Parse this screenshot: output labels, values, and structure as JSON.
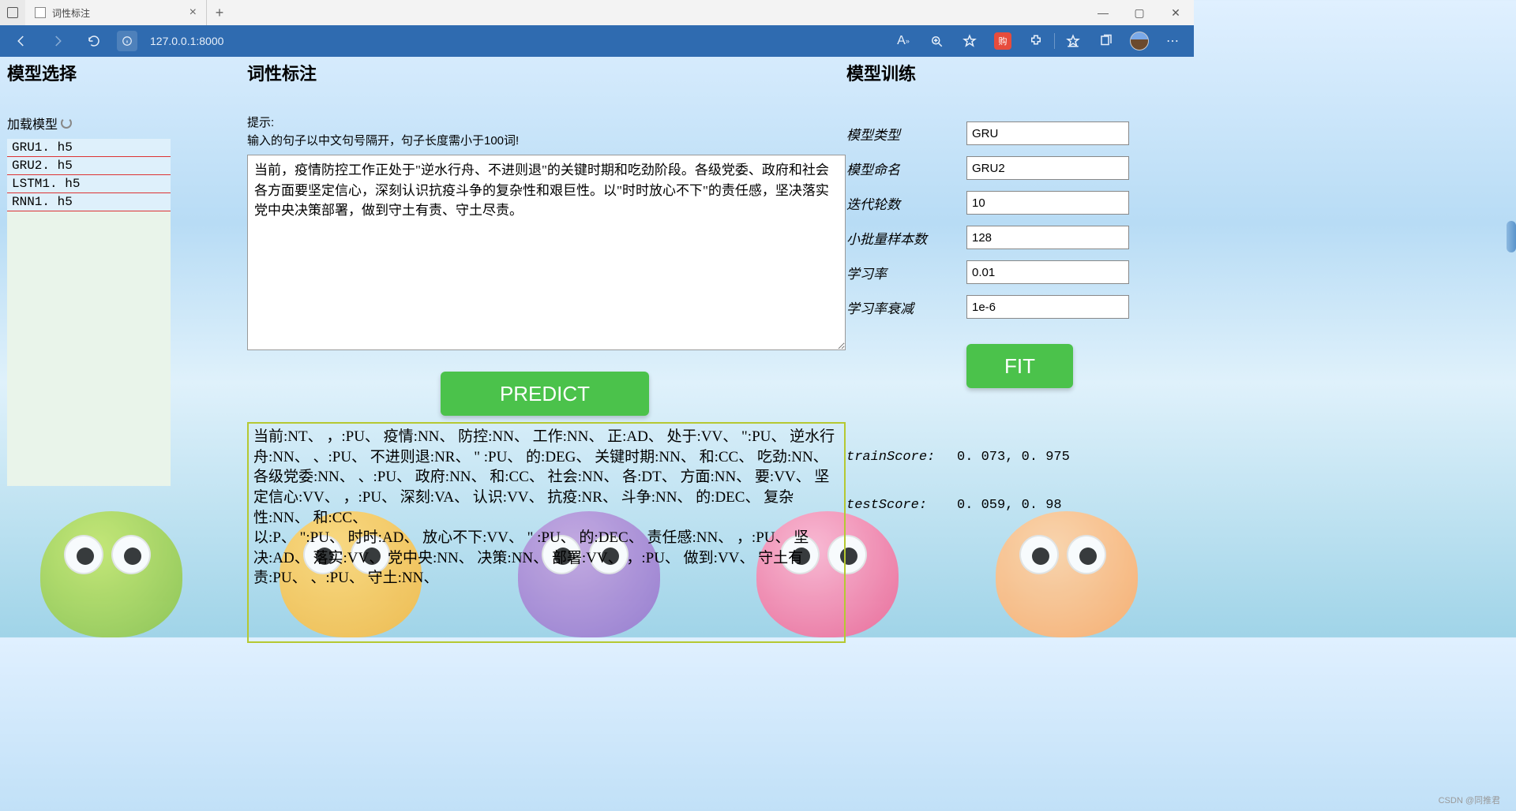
{
  "browser": {
    "tab_title": "词性标注",
    "url": "127.0.0.1:8000",
    "new_tab_tooltip": "+"
  },
  "left": {
    "heading": "模型选择",
    "load_label": "加载模型",
    "models": [
      "GRU1. h5",
      "GRU2. h5",
      "LSTM1. h5",
      "RNN1. h5"
    ]
  },
  "mid": {
    "heading": "词性标注",
    "hint_label": "提示:",
    "hint_text": "输入的句子以中文句号隔开，句子长度需小于100词!",
    "input_text": "当前，疫情防控工作正处于\"逆水行舟、不进则退\"的关键时期和吃劲阶段。各级党委、政府和社会各方面要坚定信心，深刻认识抗疫斗争的复杂性和艰巨性。以\"时时放心不下\"的责任感，坚决落实党中央决策部署，做到守土有责、守土尽责。",
    "predict_label": "PREDICT",
    "result": "当前:NT、 ，:PU、 疫情:NN、 防控:NN、 工作:NN、 正:AD、 处于:VV、 \":PU、 逆水行舟:NN、 、:PU、 不进则退:NR、 \" :PU、 的:DEG、 关键时期:NN、 和:CC、 吃劲:NN、\n各级党委:NN、 、:PU、 政府:NN、 和:CC、 社会:NN、 各:DT、 方面:NN、 要:VV、 坚定信心:VV、 ，:PU、 深刻:VA、 认识:VV、 抗疫:NR、 斗争:NN、 的:DEC、 复杂性:NN、 和:CC、\n以:P、 \":PU、 时时:AD、 放心不下:VV、 \" :PU、 的:DEC、 责任感:NN、 ，:PU、 坚决:AD、 落实:VV、 党中央:NN、 决策:NN、 部署:VV、 ，:PU、 做到:VV、 守土有责:PU、 、:PU、 守土:NN、"
  },
  "right": {
    "heading": "模型训练",
    "fields": {
      "model_type": {
        "label": "模型类型",
        "value": "GRU"
      },
      "model_name": {
        "label": "模型命名",
        "value": "GRU2"
      },
      "epochs": {
        "label": "迭代轮数",
        "value": "10"
      },
      "batch": {
        "label": "小批量样本数",
        "value": "128"
      },
      "lr": {
        "label": "学习率",
        "value": "0.01"
      },
      "lr_decay": {
        "label": "学习率衰减",
        "value": "1e-6"
      }
    },
    "fit_label": "FIT",
    "train_score_label": "trainScore:",
    "train_score_value": "0. 073, 0. 975",
    "test_score_label": "testScore:",
    "test_score_value": "0. 059, 0. 98"
  },
  "watermark": "CSDN @同推君"
}
